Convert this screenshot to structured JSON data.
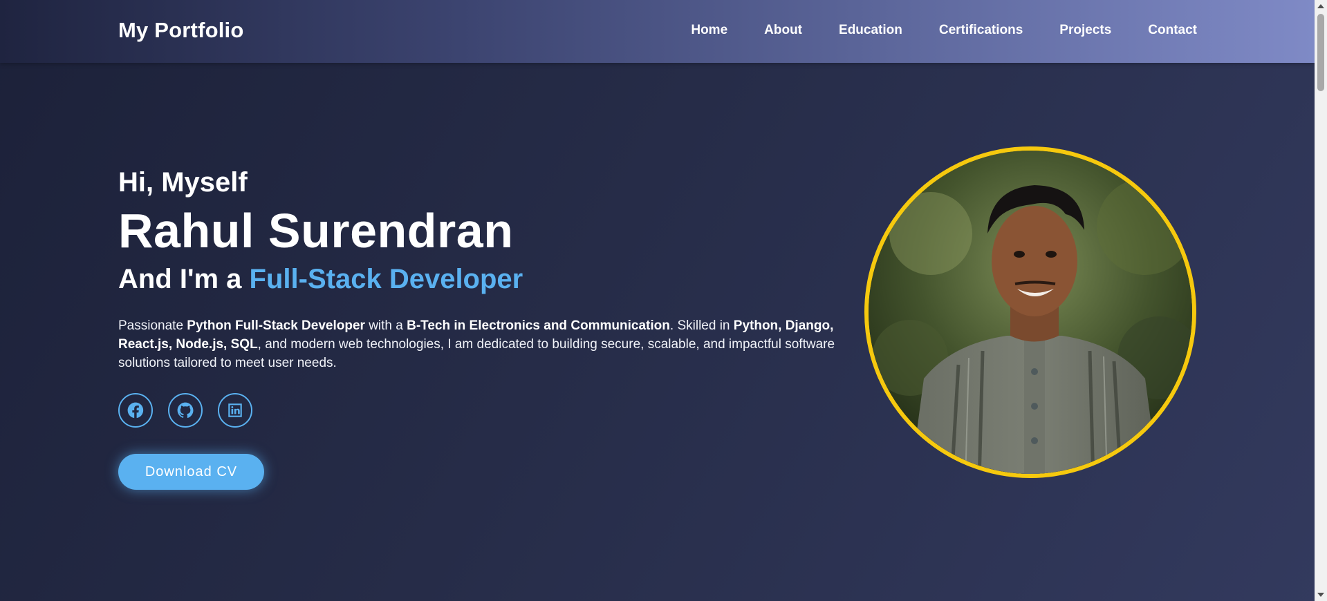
{
  "navbar": {
    "brand": "My Portfolio",
    "links": [
      "Home",
      "About",
      "Education",
      "Certifications",
      "Projects",
      "Contact"
    ]
  },
  "hero": {
    "greeting": "Hi, Myself",
    "name": "Rahul Surendran",
    "role_prefix": "And I'm a",
    "role_highlight": "Full-Stack Developer",
    "bio": {
      "t1": "Passionate ",
      "b1": "Python Full-Stack Developer",
      "t2": " with a ",
      "b2": "B-Tech in Electronics and Communication",
      "t3": ". Skilled in ",
      "b3": "Python, Django, React.js, Node.js, SQL",
      "t4": ", and modern web technologies, I am dedicated to building secure, scalable, and impactful software solutions tailored to meet user needs."
    },
    "socials": [
      {
        "icon": "facebook-icon"
      },
      {
        "icon": "github-icon"
      },
      {
        "icon": "linkedin-icon"
      }
    ],
    "cv_button": "Download CV"
  },
  "colors": {
    "accent": "#5ab1f0",
    "photo_border": "#f6c90e",
    "background": "#262c48"
  }
}
